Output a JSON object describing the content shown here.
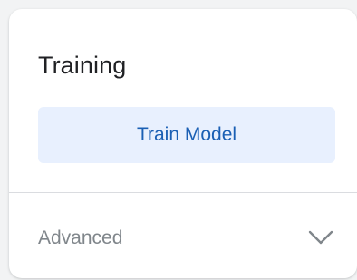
{
  "panel": {
    "title": "Training",
    "train_button_label": "Train Model",
    "advanced": {
      "label": "Advanced",
      "icon": "chevron-down-icon",
      "expanded": false
    }
  },
  "colors": {
    "title_text": "#202124",
    "button_background": "#e8f0fe",
    "button_text": "#1a5fb4",
    "muted_text": "#80868b",
    "divider": "#dadce0"
  }
}
